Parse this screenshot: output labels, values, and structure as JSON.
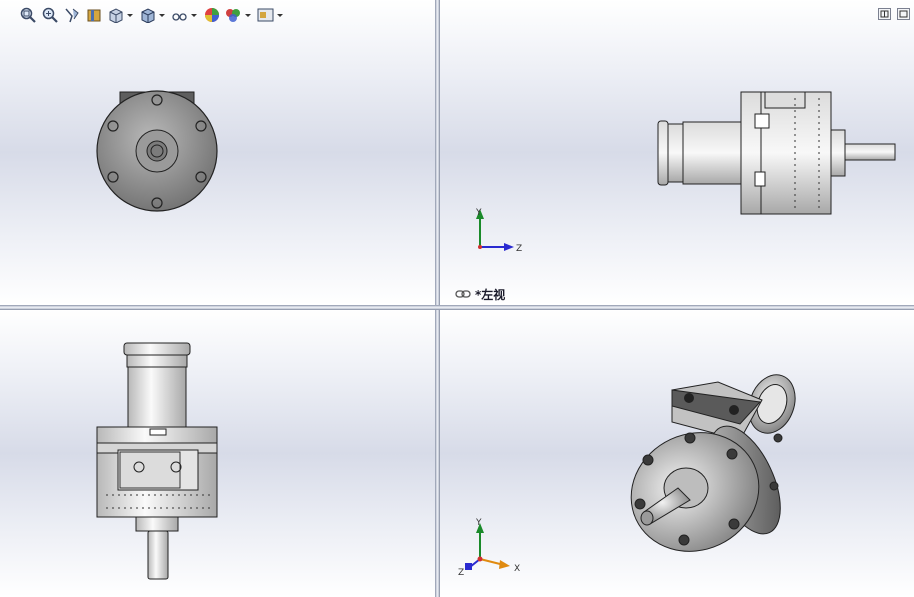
{
  "toolbar": {
    "buttons": [
      {
        "name": "zoom-to-fit-icon"
      },
      {
        "name": "zoom-to-area-icon"
      },
      {
        "name": "previous-view-icon"
      },
      {
        "name": "section-view-icon"
      },
      {
        "name": "view-orientation-icon",
        "dropdown": true
      },
      {
        "name": "display-style-icon",
        "dropdown": true
      },
      {
        "name": "hide-show-items-icon",
        "dropdown": true
      },
      {
        "name": "edit-appearance-icon"
      },
      {
        "name": "apply-scene-icon",
        "dropdown": true
      },
      {
        "name": "view-settings-icon",
        "dropdown": true
      }
    ]
  },
  "viewports": {
    "top_right": {
      "label": "*左视",
      "triad": {
        "y": "Y",
        "z": "Z"
      }
    },
    "bottom_right": {
      "triad": {
        "y": "Y",
        "x": "X",
        "z": "Z"
      }
    }
  },
  "colors": {
    "background_top": "#ffffff",
    "background_mid": "#d7dbe8",
    "splitter": "#8a93a8",
    "triad_y": "#1a8a2a",
    "triad_z": "#2a2ad0",
    "triad_x": "#e08a10"
  }
}
